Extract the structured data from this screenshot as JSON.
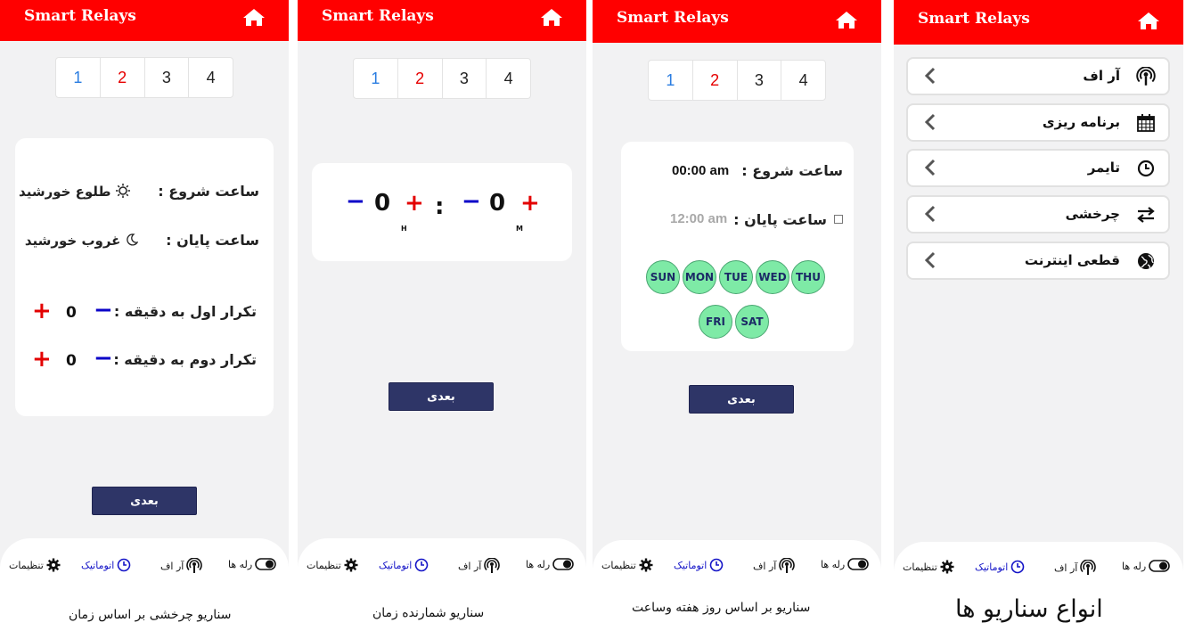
{
  "app": {
    "title": "Smart Relays"
  },
  "tabs": [
    "1",
    "2",
    "3",
    "4"
  ],
  "next_label": "بعدی",
  "nav": {
    "relays": "رله ها",
    "rf": "آر اف",
    "auto": "اتوماتیک",
    "settings": "تنظیمات"
  },
  "screen1": {
    "start_label": "ساعت شروع :",
    "start_value": "طلوع خورشید",
    "end_label": "ساعت پایان :",
    "end_value": "غروب خورشید",
    "repeat1_label": "تکرار اول به دقیقه :",
    "repeat1_value": "0",
    "repeat2_label": "تکرار دوم به دقیقه :",
    "repeat2_value": "0",
    "caption": "سناریو چرخشی بر اساس زمان"
  },
  "screen2": {
    "hours_value": "0",
    "minutes_value": "0",
    "hours_unit": "H",
    "minutes_unit": "M",
    "separator": ":",
    "caption": "سناریو شمارنده زمان"
  },
  "screen3": {
    "start_label": "ساعت شروع :",
    "start_value": "00:00 am",
    "end_label": "ساعت پایان :",
    "end_value": "12:00 am",
    "days": [
      "SUN",
      "MON",
      "TUE",
      "WED",
      "THU",
      "FRI",
      "SAT"
    ],
    "caption": "سناریو بر اساس روز هفته وساعت"
  },
  "screen4": {
    "menu": [
      {
        "label": "آر اف",
        "icon": "podcast-icon"
      },
      {
        "label": "برنامه ریزی",
        "icon": "calendar-icon"
      },
      {
        "label": "تایمر",
        "icon": "clock-icon"
      },
      {
        "label": "چرخشی",
        "icon": "exchange-icon"
      },
      {
        "label": "قطعی اینترنت",
        "icon": "globe-icon"
      }
    ],
    "caption": "انواع سناریو ها"
  },
  "colors": {
    "header": "#ff0000",
    "button": "#2e3567",
    "plus": "#e30000",
    "minus": "#0a00c8",
    "day_chip": "#7eeaa6",
    "active_nav": "#1313c7"
  }
}
